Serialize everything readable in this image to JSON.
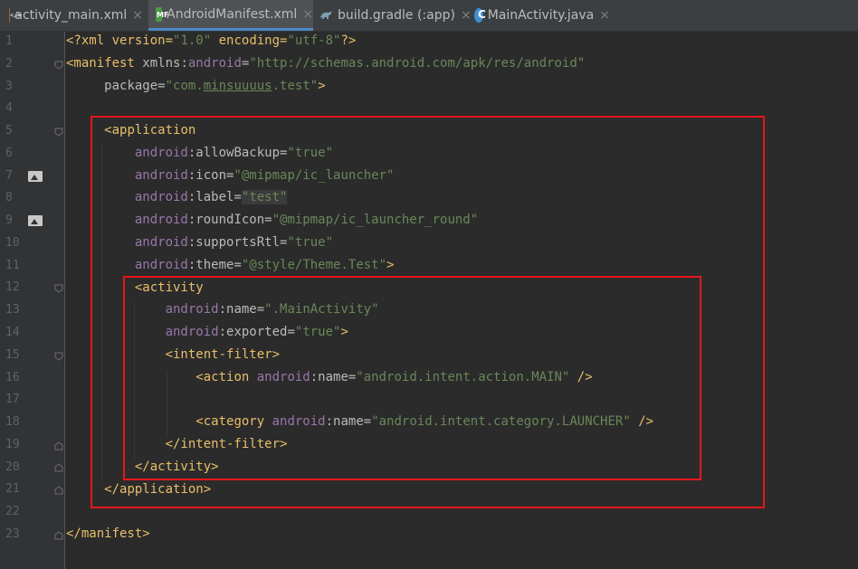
{
  "tabs": [
    {
      "label": "activity_main.xml",
      "icon": "xml-file-icon"
    },
    {
      "label": "AndroidManifest.xml",
      "icon": "manifest-file-icon"
    },
    {
      "label": "build.gradle (:app)",
      "icon": "gradle-file-icon"
    },
    {
      "label": "MainActivity.java",
      "icon": "java-class-icon"
    }
  ],
  "active_tab": "AndroidManifest.xml",
  "close_glyph": "×",
  "line_numbers": [
    "1",
    "2",
    "3",
    "4",
    "5",
    "6",
    "7",
    "8",
    "9",
    "10",
    "11",
    "12",
    "13",
    "14",
    "15",
    "16",
    "17",
    "18",
    "19",
    "20",
    "21",
    "22",
    "23"
  ],
  "code": {
    "l1": {
      "a": "<?xml version=",
      "b": "\"1.0\"",
      "c": " encoding=",
      "d": "\"utf-8\"",
      "e": "?>"
    },
    "l2": {
      "a": "<manifest ",
      "b": "xmlns:",
      "c": "android",
      "d": "=",
      "e": "\"http://schemas.android.com/apk/res/android\""
    },
    "l3": {
      "a": "package=",
      "b": "\"com.",
      "c": "minsuuuus",
      "d": ".test\"",
      "e": ">"
    },
    "l5": {
      "a": "<application"
    },
    "l6": {
      "ns": "android",
      "attr": ":allowBackup=",
      "val": "\"true\""
    },
    "l7": {
      "ns": "android",
      "attr": ":icon=",
      "val": "\"@mipmap/ic_launcher\""
    },
    "l8": {
      "ns": "android",
      "attr": ":label=",
      "val": "\"test\""
    },
    "l9": {
      "ns": "android",
      "attr": ":roundIcon=",
      "val": "\"@mipmap/ic_launcher_round\""
    },
    "l10": {
      "ns": "android",
      "attr": ":supportsRtl=",
      "val": "\"true\""
    },
    "l11": {
      "ns": "android",
      "attr": ":theme=",
      "val": "\"@style/Theme.Test\"",
      "end": ">"
    },
    "l12": {
      "a": "<activity"
    },
    "l13": {
      "ns": "android",
      "attr": ":name=",
      "val": "\".MainActivity\""
    },
    "l14": {
      "ns": "android",
      "attr": ":exported=",
      "val": "\"true\"",
      "end": ">"
    },
    "l15": {
      "a": "<intent-filter>"
    },
    "l16": {
      "a": "<action ",
      "ns": "android",
      "attr": ":name=",
      "val": "\"android.intent.action.MAIN\"",
      "end": " />"
    },
    "l18": {
      "a": "<category ",
      "ns": "android",
      "attr": ":name=",
      "val": "\"android.intent.category.LAUNCHER\"",
      "end": " />"
    },
    "l19": {
      "a": "</intent-filter>"
    },
    "l20": {
      "a": "</activity>"
    },
    "l21": {
      "a": "</application>"
    },
    "l23": {
      "a": "</manifest>"
    }
  },
  "colors": {
    "background": "#2b2b2b",
    "tag": "#e8bf6a",
    "attribute": "#bababa",
    "namespace": "#9876aa",
    "string": "#6a8759",
    "highlight_box": "#e8151b"
  }
}
